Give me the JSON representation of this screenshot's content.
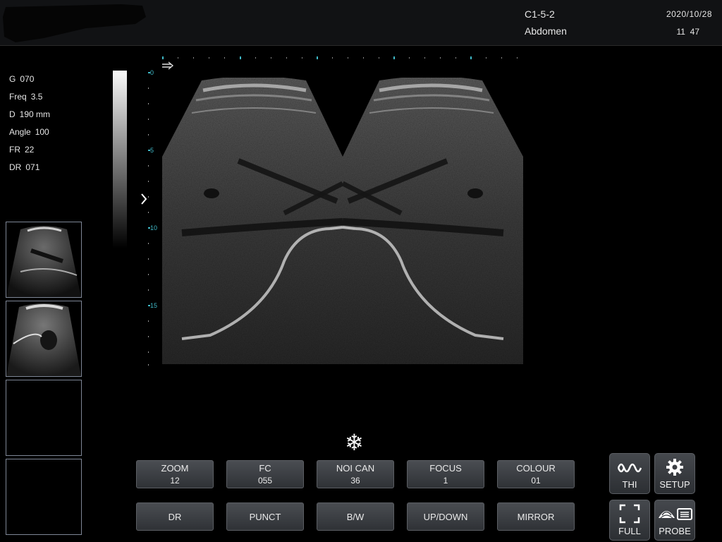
{
  "header": {
    "probe": "C1-5-2",
    "preset": "Abdomen",
    "date": "2020/10/28",
    "time": "11  47"
  },
  "params": [
    {
      "label": "G",
      "value": "070"
    },
    {
      "label": "Freq",
      "value": "3.5"
    },
    {
      "label": "D",
      "value": "190 mm"
    },
    {
      "label": "Angle",
      "value": "100"
    },
    {
      "label": "FR",
      "value": "22"
    },
    {
      "label": "DR",
      "value": "071"
    }
  ],
  "depth_scale": {
    "labels": [
      "0",
      "5",
      "10",
      "15"
    ],
    "unit_color": "#3fb9c7"
  },
  "softkeys_top": [
    {
      "label": "ZOOM",
      "value": "12"
    },
    {
      "label": "FC",
      "value": "055"
    },
    {
      "label": "NOI CAN",
      "value": "36"
    },
    {
      "label": "FOCUS",
      "value": "1"
    },
    {
      "label": "COLOUR",
      "value": "01"
    }
  ],
  "softkeys_bottom": [
    {
      "label": "DR"
    },
    {
      "label": "PUNCT"
    },
    {
      "label": "B/W"
    },
    {
      "label": "UP/DOWN"
    },
    {
      "label": "MIRROR"
    }
  ],
  "icon_buttons": [
    {
      "label": "THI",
      "icon": "thi-wave-icon"
    },
    {
      "label": "SETUP",
      "icon": "gear-icon"
    },
    {
      "label": "FULL",
      "icon": "fullscreen-icon"
    },
    {
      "label": "PROBE",
      "icon": "probe-icon"
    }
  ],
  "freeze_symbol": "❄",
  "colors": {
    "accent_tick": "#3fb9c7",
    "button_bg": "#3d4045",
    "background": "#000000"
  }
}
